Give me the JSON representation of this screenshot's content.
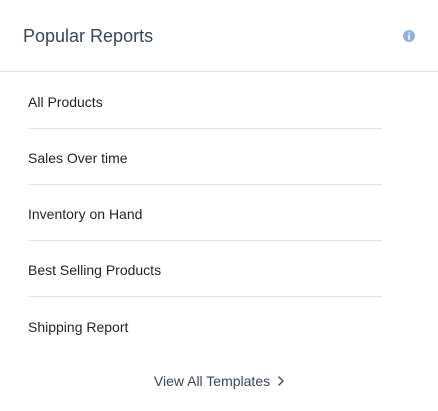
{
  "card": {
    "title": "Popular Reports",
    "info_icon": "info-icon",
    "reports": [
      {
        "label": "All Products"
      },
      {
        "label": "Sales Over time"
      },
      {
        "label": "Inventory on Hand"
      },
      {
        "label": "Best Selling Products"
      },
      {
        "label": "Shipping Report"
      }
    ],
    "footer_link": {
      "label": "View All Templates",
      "icon": "chevron-right-icon"
    }
  },
  "colors": {
    "title_text": "#3a4654",
    "body_text": "#1f2329",
    "divider": "#e2e4e7",
    "info_icon_bg": "#8fb4de"
  }
}
